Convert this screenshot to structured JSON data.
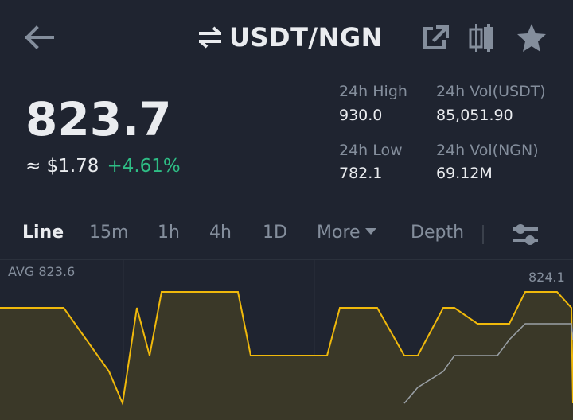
{
  "header": {
    "pair": "USDT/NGN",
    "icons": [
      "back-arrow-icon",
      "swap-icon",
      "external-link-icon",
      "candlestick-icon",
      "star-icon"
    ]
  },
  "ticker": {
    "last_price": "823.7",
    "usd_equiv": "≈ $1.78",
    "change": "+4.61%",
    "high_label": "24h High",
    "high_value": "930.0",
    "vol_usdt_label": "24h Vol(USDT)",
    "vol_usdt_value": "85,051.90",
    "low_label": "24h Low",
    "low_value": "782.1",
    "vol_ngn_label": "24h Vol(NGN)",
    "vol_ngn_value": "69.12M"
  },
  "tabs": [
    {
      "label": "Line",
      "active": true
    },
    {
      "label": "15m"
    },
    {
      "label": "1h"
    },
    {
      "label": "4h"
    },
    {
      "label": "1D"
    },
    {
      "label": "More"
    },
    {
      "label": "Depth"
    }
  ],
  "chart": {
    "avg_label": "AVG 823.6",
    "ymax_label": "824.1",
    "colors": {
      "price": "#f0b90b",
      "avg": "#9aa0a6",
      "fill": "#3a3828"
    }
  },
  "chart_data": {
    "type": "line",
    "series": [
      {
        "values": [
          823.9,
          823.9,
          823.9,
          823.5,
          823.3,
          823.9,
          823.6,
          824.0,
          824.0,
          823.6,
          823.6,
          823.6,
          823.6,
          823.9,
          823.9,
          823.9,
          823.6,
          823.6,
          823.9,
          823.9,
          823.8,
          823.8,
          823.8,
          824.0,
          824.0,
          824.0,
          823.9,
          823.3
        ]
      },
      {
        "values": [
          null,
          null,
          null,
          null,
          null,
          null,
          null,
          null,
          null,
          null,
          null,
          null,
          null,
          null,
          null,
          null,
          823.3,
          823.4,
          823.5,
          823.6,
          823.6,
          823.6,
          823.7,
          823.8,
          823.8,
          823.8,
          823.8,
          823.7
        ]
      }
    ],
    "ylabel_ticks": [
      "824.1"
    ],
    "grid": true
  }
}
